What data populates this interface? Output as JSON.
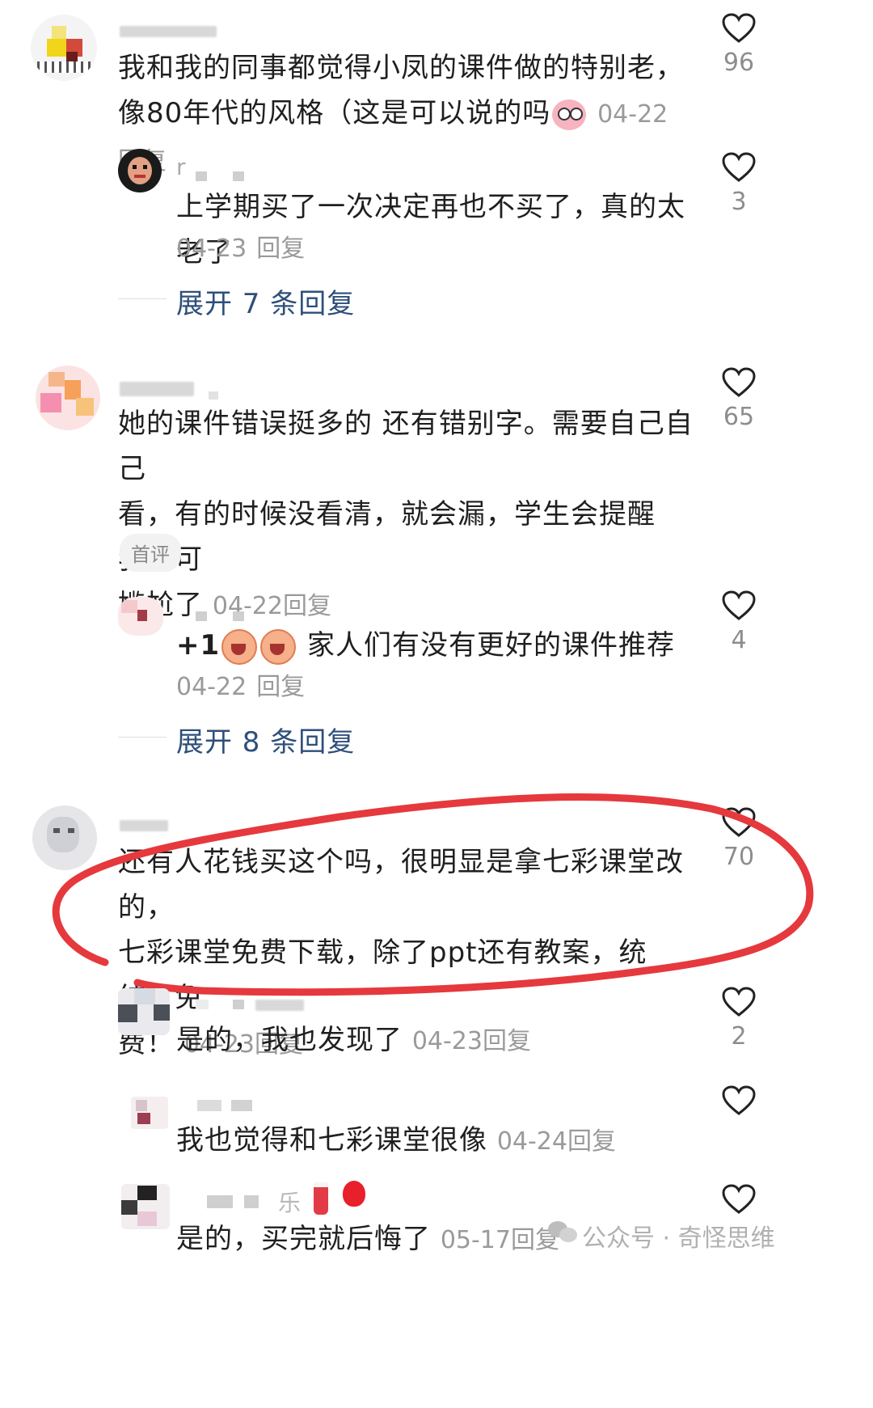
{
  "comments": [
    {
      "user": "",
      "text": "我和我的同事都觉得小凤的课件做的特别老，像80年代的风格（这是可以说的吗",
      "date": "04-22",
      "reply": "回复",
      "likes": "96",
      "replies": [
        {
          "user": "r",
          "text": "上学期买了一次决定再也不买了，真的太老了",
          "date": "04-23",
          "reply": "回复",
          "likes": "3"
        }
      ],
      "expand": "展开 7 条回复"
    },
    {
      "user": "",
      "text_line1": "她的课件错误挺多的 还有错别字。需要自己自己",
      "text_line2": "看，有的时候没看清，就会漏，学生会提醒我，可",
      "text_line3": "尴尬了",
      "date": "04-22",
      "reply": "回复",
      "likes": "65",
      "badge": "首评",
      "replies": [
        {
          "user": "",
          "prefix": "+1",
          "text": "家人们有没有更好的课件推荐",
          "date": "04-22",
          "reply": "回复",
          "likes": "4"
        }
      ],
      "expand": "展开 8 条回复"
    },
    {
      "user": "",
      "text_line1": "还有人花钱买这个吗，很明显是拿七彩课堂改的，",
      "text_line2": "七彩课堂免费下载，除了ppt还有教案，统统！免",
      "text_line3": "费！",
      "date": "04-23",
      "reply": "回复",
      "likes": "70",
      "replies": [
        {
          "user": "",
          "text": "是的，我也发现了",
          "date": "04-23",
          "reply": "回复",
          "likes": "2"
        },
        {
          "user": "",
          "text": "我也觉得和七彩课堂很像",
          "date": "04-24",
          "reply": "回复",
          "likes": ""
        },
        {
          "user": "乐",
          "text": "是的，买完就后悔了",
          "date": "05-17",
          "reply": "回复",
          "likes": ""
        }
      ]
    }
  ],
  "watermark": "公众号 · 奇怪思维",
  "colors": {
    "link": "#2e4f7a",
    "meta": "#9a9a9a",
    "circle": "#e5393d"
  }
}
